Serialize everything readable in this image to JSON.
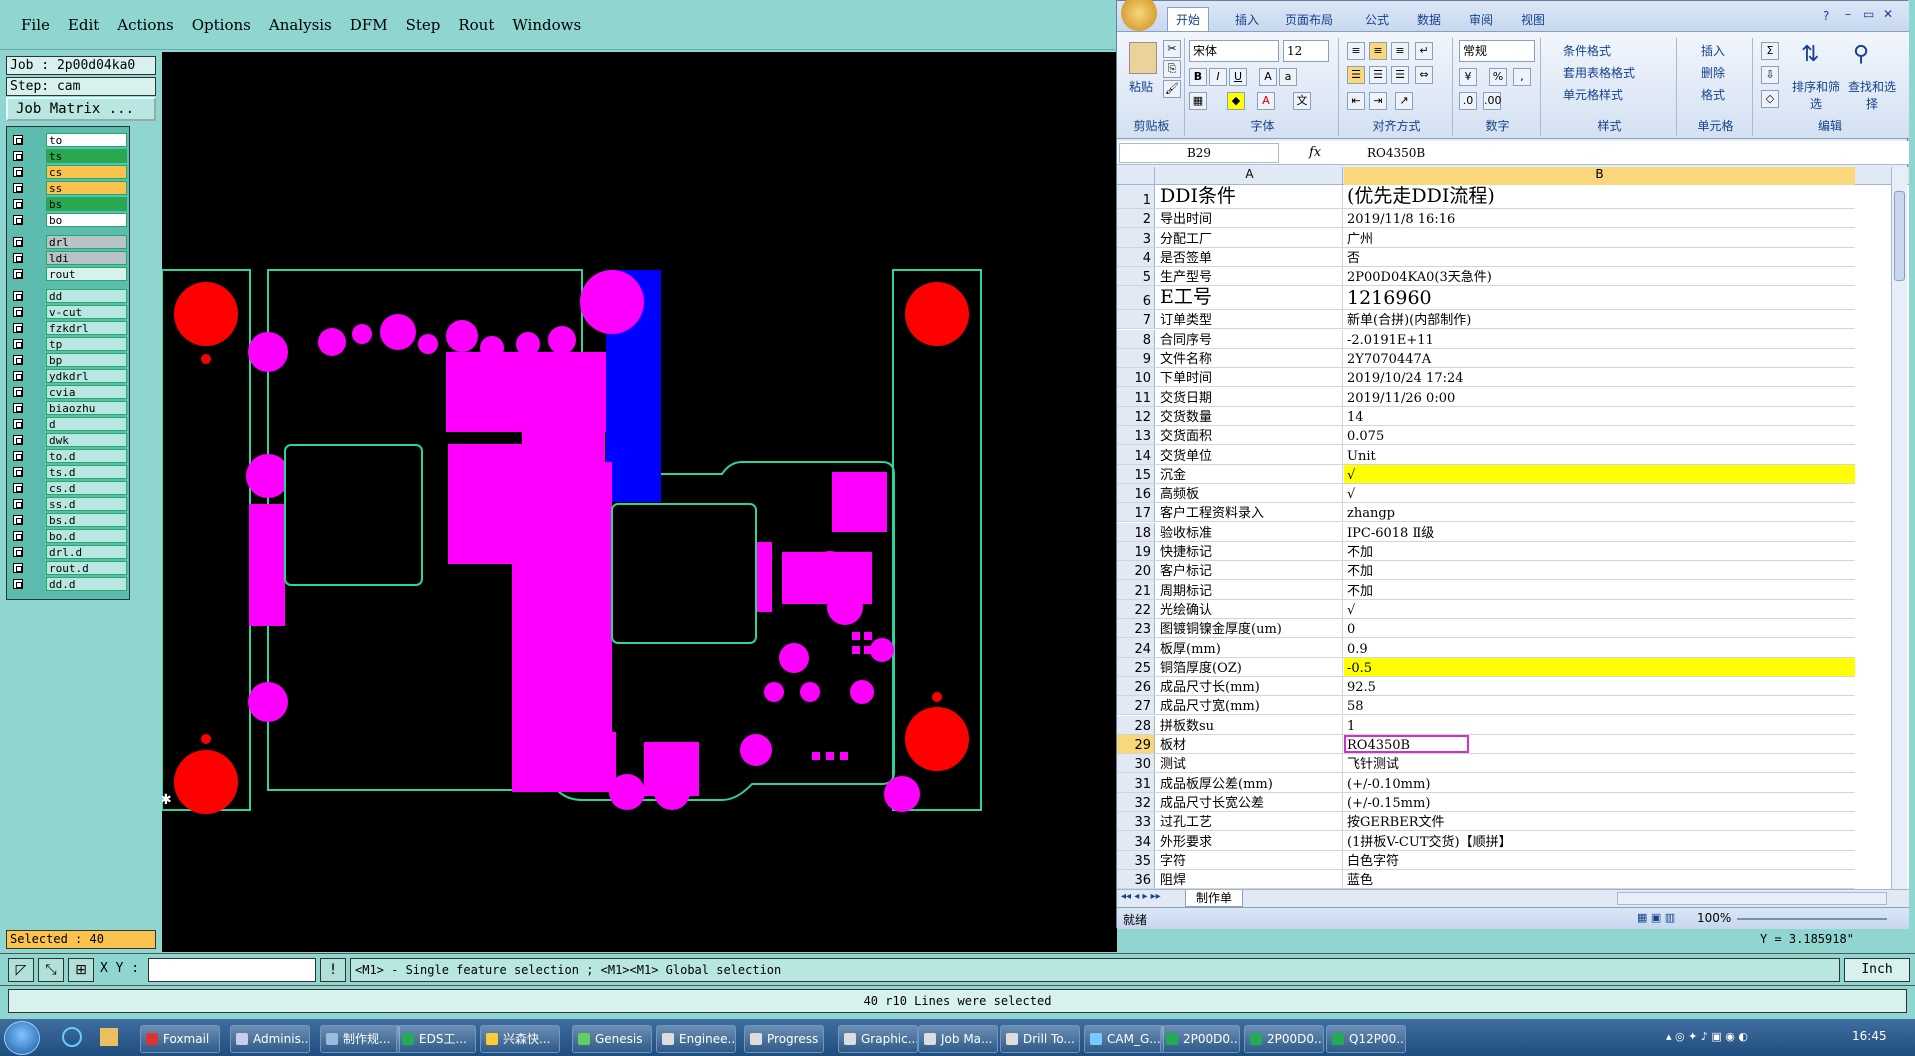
{
  "genesis": {
    "menu": [
      "File",
      "Edit",
      "Actions",
      "Options",
      "Analysis",
      "DFM",
      "Step",
      "Rout",
      "Windows"
    ],
    "job": "Job : 2p00d04ka0",
    "step": "Step: cam",
    "job_matrix": "Job Matrix ...",
    "layers": [
      {
        "name": "to",
        "color": "#ffffff"
      },
      {
        "name": "ts",
        "color": "#2aa84f"
      },
      {
        "name": "cs",
        "color": "#f9c34d"
      },
      {
        "name": "ss",
        "color": "#f9c34d"
      },
      {
        "name": "bs",
        "color": "#2aa84f"
      },
      {
        "name": "bo",
        "color": "#ffffff"
      },
      {
        "name": "drl",
        "color": "#b7c3c8"
      },
      {
        "name": "ldi",
        "color": "#b7c3c8"
      },
      {
        "name": "rout",
        "color": "#d7f2ee"
      },
      {
        "name": "dd",
        "color": "#b8e6e0"
      },
      {
        "name": "v-cut",
        "color": "#b8e6e0"
      },
      {
        "name": "fzkdrl",
        "color": "#b8e6e0"
      },
      {
        "name": "tp",
        "color": "#b8e6e0"
      },
      {
        "name": "bp",
        "color": "#b8e6e0"
      },
      {
        "name": "ydkdrl",
        "color": "#b8e6e0"
      },
      {
        "name": "cvia",
        "color": "#b8e6e0"
      },
      {
        "name": "biaozhu",
        "color": "#b8e6e0"
      },
      {
        "name": "d",
        "color": "#b8e6e0"
      },
      {
        "name": "dwk",
        "color": "#b8e6e0"
      },
      {
        "name": "to.d",
        "color": "#b8e6e0"
      },
      {
        "name": "ts.d",
        "color": "#b8e6e0"
      },
      {
        "name": "cs.d",
        "color": "#b8e6e0"
      },
      {
        "name": "ss.d",
        "color": "#b8e6e0"
      },
      {
        "name": "bs.d",
        "color": "#b8e6e0"
      },
      {
        "name": "bo.d",
        "color": "#b8e6e0"
      },
      {
        "name": "drl.d",
        "color": "#b8e6e0"
      },
      {
        "name": "rout.d",
        "color": "#b8e6e0"
      },
      {
        "name": "dd.d",
        "color": "#b8e6e0"
      }
    ],
    "selected": "Selected : 40",
    "xy_label": "X Y :",
    "hint": "<M1> - Single feature selection ; <M1><M1> Global selection",
    "unit": "Inch",
    "status": "40 r10 Lines were selected",
    "coord_readout": "Y = 3.185918\""
  },
  "excel": {
    "tabs": [
      "开始",
      "插入",
      "页面布局",
      "公式",
      "数据",
      "审阅",
      "视图"
    ],
    "ribbon": {
      "paste": "粘贴",
      "clipboard": "剪贴板",
      "font_name": "宋体",
      "font_size": "12",
      "font_group": "字体",
      "align_group": "对齐方式",
      "number_format": "常规",
      "number_group": "数字",
      "cond_format": "条件格式",
      "table_format": "套用表格格式",
      "cell_style": "单元格样式",
      "style_group": "样式",
      "insert": "插入",
      "delete": "删除",
      "format": "格式",
      "cells_group": "单元格",
      "sort_filter": "排序和筛选",
      "find_select": "查找和选择",
      "edit_group": "编辑"
    },
    "name_box": "B29",
    "formula_value": "RO4350B",
    "col_a": "A",
    "col_b": "B",
    "rows": [
      {
        "n": "1",
        "a": "DDI条件",
        "b": "(优先走DDI流程)",
        "big": true
      },
      {
        "n": "2",
        "a": "导出时间",
        "b": "2019/11/8 16:16"
      },
      {
        "n": "3",
        "a": "分配工厂",
        "b": "广州"
      },
      {
        "n": "4",
        "a": "是否签单",
        "b": "否"
      },
      {
        "n": "5",
        "a": "生产型号",
        "b": "2P00D04KA0(3天急件)"
      },
      {
        "n": "6",
        "a": "E工号",
        "b": "1216960",
        "big": true
      },
      {
        "n": "7",
        "a": "订单类型",
        "b": "新单(合拼)(内部制作)"
      },
      {
        "n": "8",
        "a": "合同序号",
        "b": "-2.0191E+11"
      },
      {
        "n": "9",
        "a": "文件名称",
        "b": "2Y7070447A"
      },
      {
        "n": "10",
        "a": "下单时间",
        "b": "2019/10/24 17:24"
      },
      {
        "n": "11",
        "a": "交货日期",
        "b": "2019/11/26 0:00"
      },
      {
        "n": "12",
        "a": "交货数量",
        "b": "14"
      },
      {
        "n": "13",
        "a": "交货面积",
        "b": "0.075"
      },
      {
        "n": "14",
        "a": "交货单位",
        "b": "Unit"
      },
      {
        "n": "15",
        "a": "沉金",
        "b": "√",
        "hl": true
      },
      {
        "n": "16",
        "a": "高频板",
        "b": "√"
      },
      {
        "n": "17",
        "a": "客户工程资料录入",
        "b": "zhangp"
      },
      {
        "n": "18",
        "a": "验收标准",
        "b": "IPC-6018 Ⅱ级"
      },
      {
        "n": "19",
        "a": "快捷标记",
        "b": "不加"
      },
      {
        "n": "20",
        "a": "客户标记",
        "b": "不加"
      },
      {
        "n": "21",
        "a": "周期标记",
        "b": "不加"
      },
      {
        "n": "22",
        "a": "光绘确认",
        "b": "√"
      },
      {
        "n": "23",
        "a": "图镀铜镍金厚度(um)",
        "b": "0"
      },
      {
        "n": "24",
        "a": "板厚(mm)",
        "b": "0.9"
      },
      {
        "n": "25",
        "a": "铜箔厚度(OZ)",
        "b": "-0.5",
        "hl": true
      },
      {
        "n": "26",
        "a": "成品尺寸长(mm)",
        "b": "92.5"
      },
      {
        "n": "27",
        "a": "成品尺寸宽(mm)",
        "b": "58"
      },
      {
        "n": "28",
        "a": "拼板数su",
        "b": "1"
      },
      {
        "n": "29",
        "a": "板材",
        "b": "RO4350B",
        "sel": true
      },
      {
        "n": "30",
        "a": "测试",
        "b": "飞针测试"
      },
      {
        "n": "31",
        "a": "成品板厚公差(mm)",
        "b": "(+/-0.10mm)"
      },
      {
        "n": "32",
        "a": "成品尺寸长宽公差",
        "b": "(+/-0.15mm)"
      },
      {
        "n": "33",
        "a": "过孔工艺",
        "b": "按GERBER文件"
      },
      {
        "n": "34",
        "a": "外形要求",
        "b": "(1拼板V-CUT交货)【顺拼】"
      },
      {
        "n": "35",
        "a": "字符",
        "b": "白色字符"
      },
      {
        "n": "36",
        "a": "阻焊",
        "b": "蓝色"
      }
    ],
    "sheet_tab": "制作单",
    "status_left": "就绪",
    "zoom": "100%"
  },
  "taskbar": {
    "items": [
      {
        "label": "Foxmail",
        "color": "#d33"
      },
      {
        "label": "Adminis...",
        "color": "#cce"
      },
      {
        "label": "制作规...",
        "color": "#9bd"
      },
      {
        "label": "EDS工...",
        "color": "#2a5"
      },
      {
        "label": "兴森快...",
        "color": "#fc3"
      },
      {
        "label": "Genesis",
        "color": "#6c6"
      },
      {
        "label": "Enginee...",
        "color": "#ddd"
      },
      {
        "label": "Progress",
        "color": "#ddd"
      },
      {
        "label": "Graphic...",
        "color": "#ddd"
      },
      {
        "label": "Job Ma...",
        "color": "#ddd"
      },
      {
        "label": "Drill To...",
        "color": "#ddd"
      },
      {
        "label": "CAM_G...",
        "color": "#7cf"
      },
      {
        "label": "2P00D0...",
        "color": "#2a5"
      },
      {
        "label": "2P00D0...",
        "color": "#2a5"
      },
      {
        "label": "Q12P00...",
        "color": "#2a5"
      }
    ],
    "clock": "16:45"
  }
}
